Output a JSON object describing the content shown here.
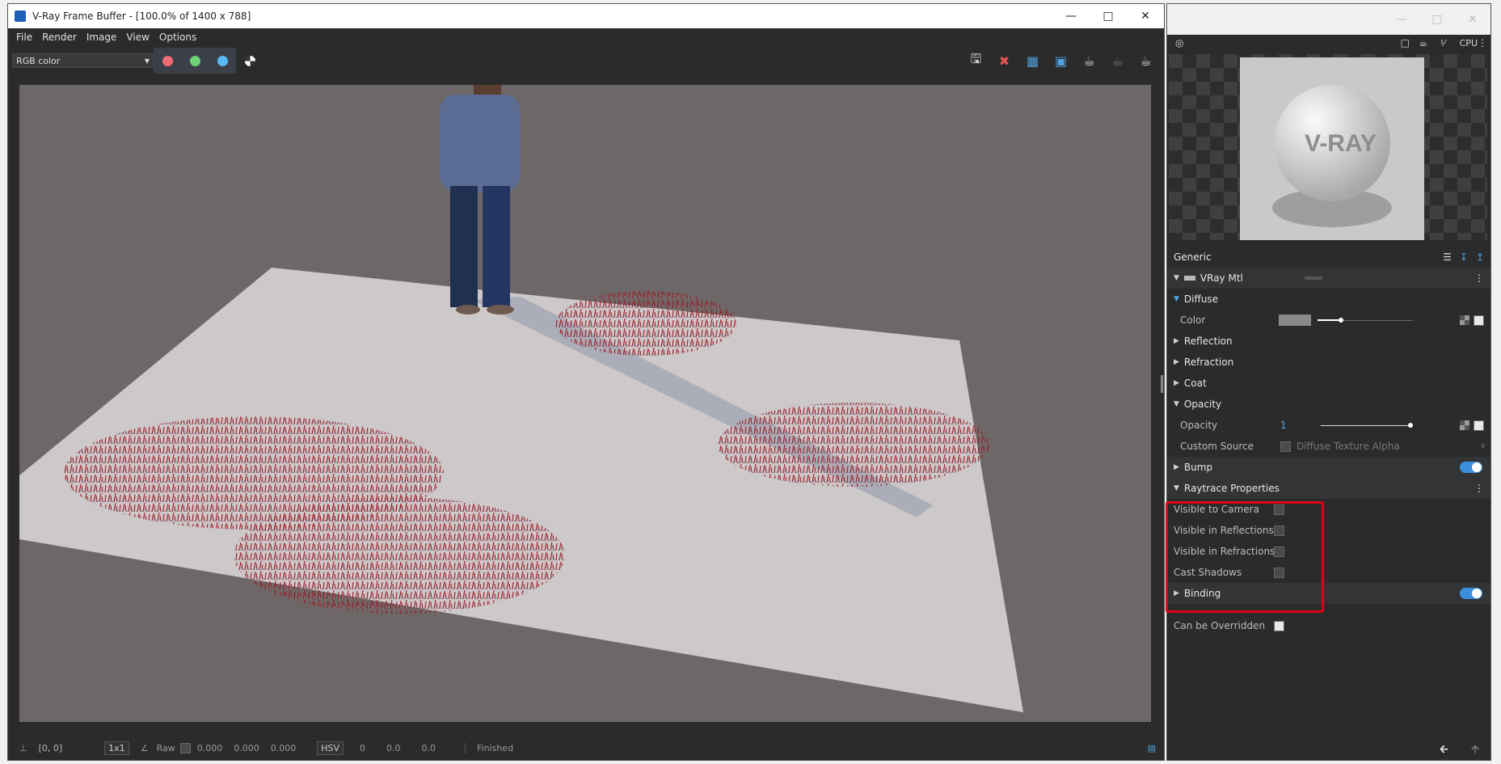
{
  "vfb": {
    "title": "V-Ray Frame Buffer - [100.0% of 1400 x 788]",
    "menu": [
      "File",
      "Render",
      "Image",
      "View",
      "Options"
    ],
    "channel_select": "RGB color",
    "status": {
      "coords": "[0, 0]",
      "sample": "1x1",
      "raw_label": "Raw",
      "r": "0.000",
      "g": "0.000",
      "b": "0.000",
      "color_mode": "HSV",
      "h": "0",
      "s": "0.0",
      "v": "0.0",
      "state": "Finished"
    }
  },
  "panel": {
    "render_mode": "CPU",
    "preview_text": "V-RAY",
    "category": "Generic",
    "material": "VRay Mtl",
    "sections": {
      "diffuse": "Diffuse",
      "color_label": "Color",
      "reflection": "Reflection",
      "refraction": "Refraction",
      "coat": "Coat",
      "opacity": "Opacity",
      "opacity_label": "Opacity",
      "opacity_value": "1",
      "custom_source_label": "Custom Source",
      "custom_source_value": "Diffuse Texture Alpha",
      "bump": "Bump",
      "raytrace": "Raytrace Properties",
      "visible_camera": "Visible to Camera",
      "visible_reflections": "Visible in Reflections",
      "visible_refractions": "Visible in Refractions",
      "cast_shadows": "Cast Shadows",
      "binding": "Binding",
      "can_be_overridden": "Can be Overridden"
    }
  }
}
